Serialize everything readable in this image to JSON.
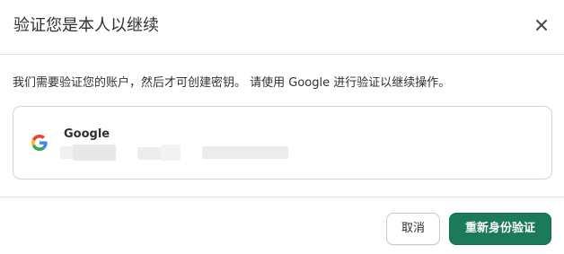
{
  "dialog": {
    "title": "验证您是本人以继续",
    "close_icon": "close-icon",
    "message": "我们需要验证您的账户，然后才可创建密钥。 请使用 Google 进行验证以继续操作。",
    "account": {
      "provider_icon": "google-icon",
      "provider_name": "Google"
    },
    "buttons": {
      "cancel": "取消",
      "reauthenticate": "重新身份验证"
    }
  },
  "colors": {
    "primary": "#1a7a5a",
    "text": "#303030",
    "border": "#d4d4d4"
  }
}
